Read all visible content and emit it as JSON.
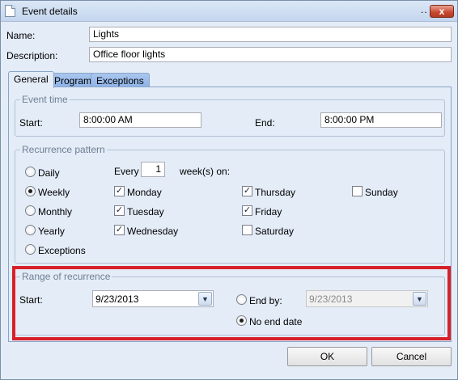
{
  "window": {
    "title": "Event details",
    "title_dots": "..",
    "close_glyph": "x"
  },
  "name": {
    "label": "Name:",
    "value": "Lights"
  },
  "description": {
    "label": "Description:",
    "value": "Office floor lights"
  },
  "tabs": [
    {
      "label": "General",
      "active": true
    },
    {
      "label": "Program",
      "active": false
    },
    {
      "label": "Exceptions",
      "active": false
    }
  ],
  "event_time": {
    "legend": "Event time",
    "start_label": "Start:",
    "start_value": "8:00:00 AM",
    "end_label": "End:",
    "end_value": "8:00:00 PM"
  },
  "recurrence": {
    "legend": "Recurrence pattern",
    "options": [
      "Daily",
      "Weekly",
      "Monthly",
      "Yearly",
      "Exceptions"
    ],
    "selected": "Weekly",
    "every_label": "Every",
    "every_value": "1",
    "weeks_on_label": "week(s) on:",
    "days": [
      {
        "label": "Monday",
        "checked": true
      },
      {
        "label": "Tuesday",
        "checked": true
      },
      {
        "label": "Wednesday",
        "checked": true
      },
      {
        "label": "Thursday",
        "checked": true
      },
      {
        "label": "Friday",
        "checked": true
      },
      {
        "label": "Saturday",
        "checked": false
      },
      {
        "label": "Sunday",
        "checked": false
      }
    ]
  },
  "range": {
    "legend": "Range of recurrence",
    "start_label": "Start:",
    "start_value": "9/23/2013",
    "end_by_label": "End by:",
    "end_by_value": "9/23/2013",
    "no_end_label": "No end date",
    "selected": "No end date"
  },
  "buttons": {
    "ok": "OK",
    "cancel": "Cancel"
  },
  "icons": {
    "check": "✓",
    "dropdown": "▼"
  },
  "colors": {
    "highlight_border": "#d8202a",
    "panel_bg": "#e3ecf7"
  }
}
